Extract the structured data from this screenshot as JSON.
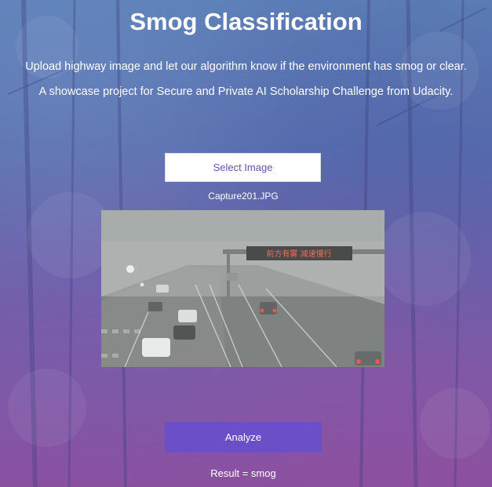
{
  "page": {
    "title": "Smog Classification",
    "description": "Upload highway image and let our algorithm know if the environment has smog or clear.",
    "subtitle": "A showcase project for Secure and Private AI Scholarship Challenge from Udacity."
  },
  "upload": {
    "select_label": "Select Image",
    "file_name": "Capture201.JPG",
    "preview_sign_text": "前方有雾 减速慢行"
  },
  "analyze": {
    "button_label": "Analyze",
    "result_text": "Result = smog"
  },
  "colors": {
    "accent": "#6a4fc9",
    "select_text": "#6a4fb5",
    "text": "#ffffff"
  }
}
